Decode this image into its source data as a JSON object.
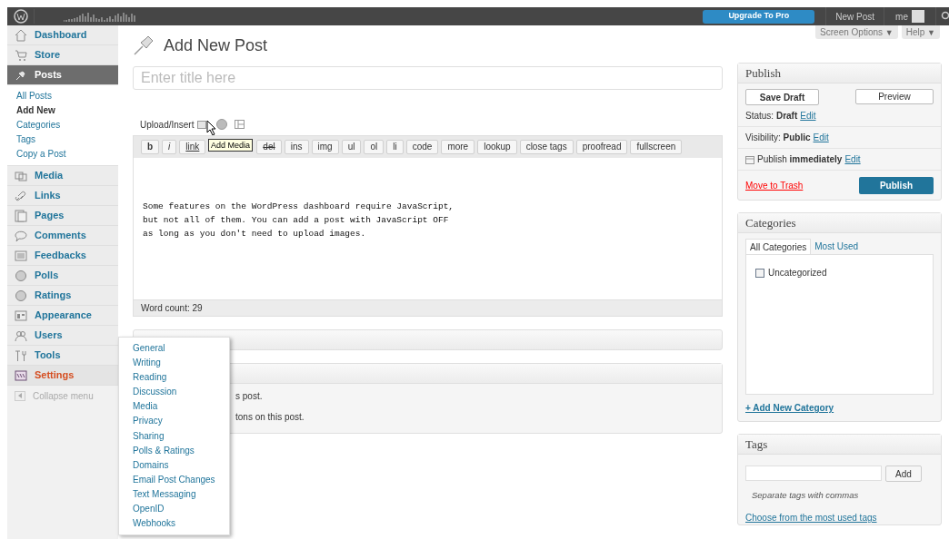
{
  "admin_bar": {
    "upgrade": "Upgrade To Pro",
    "new_post": "New Post",
    "user": "me"
  },
  "sidebar": {
    "items": [
      {
        "kind": "dashboard",
        "label": "Dashboard",
        "selected": false,
        "hovered": false
      },
      {
        "kind": "store",
        "label": "Store",
        "selected": false,
        "hovered": false
      },
      {
        "kind": "posts",
        "label": "Posts",
        "selected": true,
        "hovered": false,
        "children": [
          {
            "label": "All Posts",
            "selected": false
          },
          {
            "label": "Add New",
            "selected": true
          },
          {
            "label": "Categories",
            "selected": false
          },
          {
            "label": "Tags",
            "selected": false
          },
          {
            "label": "Copy a Post",
            "selected": false
          }
        ]
      },
      {
        "kind": "media",
        "label": "Media",
        "selected": false,
        "hovered": false
      },
      {
        "kind": "links",
        "label": "Links",
        "selected": false,
        "hovered": false
      },
      {
        "kind": "pages",
        "label": "Pages",
        "selected": false,
        "hovered": false
      },
      {
        "kind": "comments",
        "label": "Comments",
        "selected": false,
        "hovered": false
      },
      {
        "kind": "feedbacks",
        "label": "Feedbacks",
        "selected": false,
        "hovered": false
      },
      {
        "kind": "polls",
        "label": "Polls",
        "selected": false,
        "hovered": false
      },
      {
        "kind": "ratings",
        "label": "Ratings",
        "selected": false,
        "hovered": false
      },
      {
        "kind": "appearance",
        "label": "Appearance",
        "selected": false,
        "hovered": false
      },
      {
        "kind": "users",
        "label": "Users",
        "selected": false,
        "hovered": false
      },
      {
        "kind": "tools",
        "label": "Tools",
        "selected": false,
        "hovered": false
      },
      {
        "kind": "settings",
        "label": "Settings",
        "selected": false,
        "hovered": true
      }
    ],
    "collapse": "Collapse menu"
  },
  "settings_flyout": [
    "General",
    "Writing",
    "Reading",
    "Discussion",
    "Media",
    "Privacy",
    "Sharing",
    "Polls & Ratings",
    "Domains",
    "Email Post Changes",
    "Text Messaging",
    "OpenID",
    "Webhooks"
  ],
  "header": {
    "screen_options": "Screen Options",
    "help": "Help",
    "caret": "▼"
  },
  "page_title": "Add New Post",
  "title_field": {
    "placeholder": "Enter title here"
  },
  "upload": {
    "label": "Upload/Insert",
    "tooltip": "Add Media"
  },
  "toolbar": [
    {
      "kind": "bold",
      "label": "b"
    },
    {
      "kind": "italic",
      "label": "i"
    },
    {
      "kind": "link",
      "label": "link"
    },
    {
      "kind": "covered"
    },
    {
      "kind": "strike",
      "label": "del"
    },
    {
      "kind": "plain",
      "label": "ins"
    },
    {
      "kind": "plain",
      "label": "img"
    },
    {
      "kind": "plain",
      "label": "ul"
    },
    {
      "kind": "plain",
      "label": "ol"
    },
    {
      "kind": "plain",
      "label": "li"
    },
    {
      "kind": "plain",
      "label": "code"
    },
    {
      "kind": "plain",
      "label": "more"
    },
    {
      "kind": "plain",
      "label": "lookup"
    },
    {
      "kind": "plain",
      "label": "close tags"
    },
    {
      "kind": "plain",
      "label": "proofread"
    },
    {
      "kind": "plain",
      "label": "fullscreen"
    }
  ],
  "editor_lines": [
    "Some features on the WordPress dashboard require JavaScript,",
    "but not all of them. You can add a post with JavaScript OFF",
    "as long as you don't need to upload images."
  ],
  "word_count": "Word count: 29",
  "covered_box_lines": [
    "s post.",
    "tons on this post."
  ],
  "publish": {
    "title": "Publish",
    "save_draft": "Save Draft",
    "preview": "Preview",
    "rows": [
      {
        "kind": "status",
        "label": "Status:",
        "value": "Draft",
        "link": "Edit"
      },
      {
        "kind": "visibility",
        "label": "Visibility:",
        "value": "Public",
        "link": "Edit"
      },
      {
        "kind": "schedule",
        "label": "Publish",
        "value": "immediately",
        "link": "Edit"
      }
    ],
    "trash": "Move to Trash",
    "publish_button": "Publish"
  },
  "categories": {
    "title": "Categories",
    "tabs": [
      {
        "label": "All Categories",
        "selected": true
      },
      {
        "label": "Most Used",
        "selected": false
      }
    ],
    "items": [
      {
        "label": "Uncategorized",
        "checked": false
      }
    ],
    "add_new": "+ Add New Category"
  },
  "tags": {
    "title": "Tags",
    "add": "Add",
    "hint": "Separate tags with commas",
    "choose": "Choose from the most used tags"
  }
}
